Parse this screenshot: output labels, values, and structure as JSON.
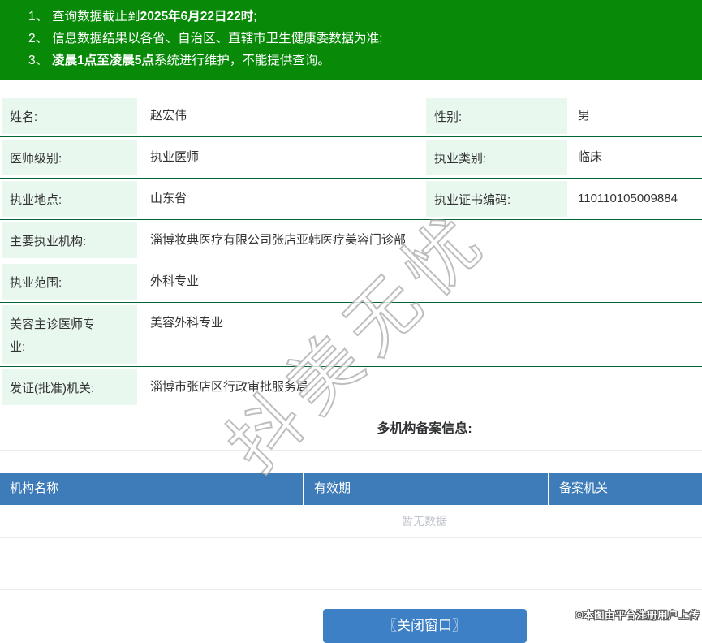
{
  "banner": {
    "bg_color": "#088A08",
    "notices": [
      {
        "num": "1、",
        "pre": "查询数据截止到",
        "bold": "2025年6月22日22时",
        "post": ";"
      },
      {
        "num": "2、",
        "pre": "信息数据结果以各省、自治区、直辖市卫生健康委数据为准;",
        "bold": "",
        "post": ""
      },
      {
        "num": "3、",
        "pre": "",
        "bold": "凌晨1点至凌晨5点",
        "post": "系统进行维护，不能提供查询。"
      }
    ]
  },
  "fields": {
    "name_label": "姓名:",
    "name_value": "赵宏伟",
    "gender_label": "性别:",
    "gender_value": "男",
    "level_label": "医师级别:",
    "level_value": "执业医师",
    "category_label": "执业类别:",
    "category_value": "临床",
    "location_label": "执业地点:",
    "location_value": "山东省",
    "cert_no_label": "执业证书编码:",
    "cert_no_value": "110110105009884",
    "org_label": "主要执业机构:",
    "org_value": "淄博妆典医疗有限公司张店亚韩医疗美容门诊部",
    "scope_label": "执业范围:",
    "scope_value": "外科专业",
    "cosmetic_label": "美容主诊医师专业:",
    "cosmetic_value": "美容外科专业",
    "authority_label": "发证(批准)机关:",
    "authority_value": "淄博市张店区行政审批服务局"
  },
  "multi_org": {
    "heading": "多机构备案信息:",
    "columns": [
      "机构名称",
      "有效期",
      "备案机关"
    ],
    "empty_text": "暂无数据",
    "header_bg_color": "#3d7cb8"
  },
  "close_button": {
    "label": "〖关闭窗口〗",
    "bg_color": "#3e80c6"
  },
  "watermark_text": "抖美无忧",
  "attribution": "©本图由平台注册用户上传",
  "colors": {
    "banner_green": "#088A08",
    "row_separator_green": "#006633",
    "label_cell_bg": "#e9f8ef",
    "empty_text_gray": "#c0c4cc"
  }
}
